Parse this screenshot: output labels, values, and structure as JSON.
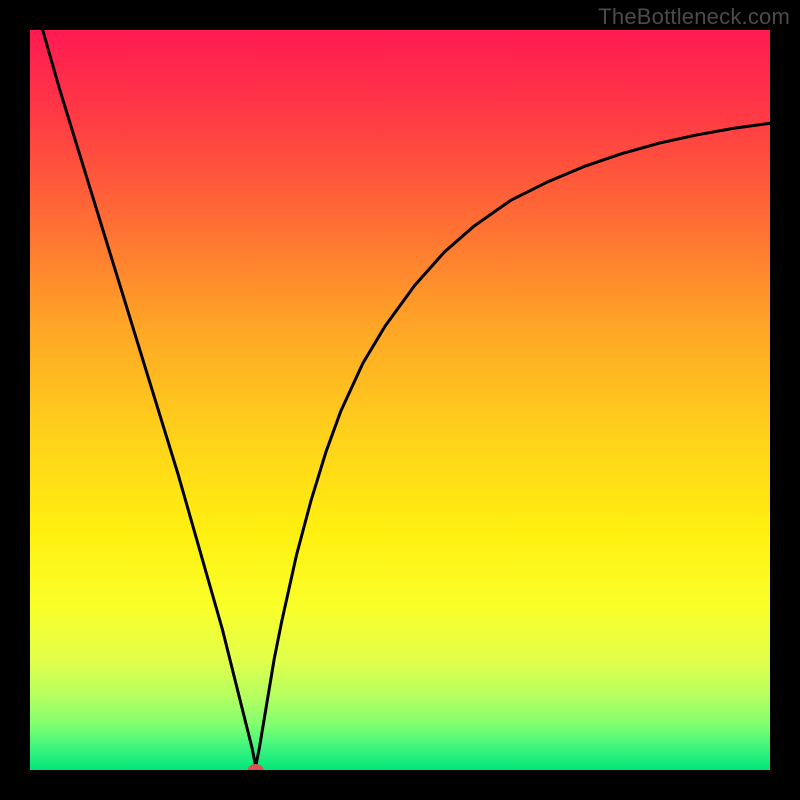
{
  "watermark": "TheBottleneck.com",
  "chart_data": {
    "type": "line",
    "title": "",
    "xlabel": "",
    "ylabel": "",
    "xlim": [
      0,
      100
    ],
    "ylim": [
      0,
      100
    ],
    "minimum_marker": {
      "x": 30.5,
      "y": 0
    },
    "series": [
      {
        "name": "curve",
        "x": [
          0,
          2,
          4,
          6,
          8,
          10,
          12,
          14,
          16,
          18,
          20,
          22,
          24,
          26,
          28,
          29,
          30,
          30.5,
          31,
          32,
          33,
          34,
          36,
          38,
          40,
          42,
          45,
          48,
          52,
          56,
          60,
          65,
          70,
          75,
          80,
          85,
          90,
          95,
          100
        ],
        "y": [
          106,
          99,
          92,
          85.5,
          79,
          72.5,
          66,
          59.5,
          53,
          46.5,
          40,
          33,
          26,
          19,
          11,
          7,
          3,
          0.5,
          3,
          9,
          15,
          20,
          29,
          36.5,
          43,
          48.5,
          55,
          60,
          65.5,
          70,
          73.5,
          77,
          79.5,
          81.6,
          83.3,
          84.7,
          85.8,
          86.7,
          87.4
        ]
      }
    ],
    "gradient_stops": [
      {
        "offset": 0.0,
        "color": "#ff1a52"
      },
      {
        "offset": 0.12,
        "color": "#ff3b44"
      },
      {
        "offset": 0.25,
        "color": "#ff6a35"
      },
      {
        "offset": 0.4,
        "color": "#ffa526"
      },
      {
        "offset": 0.55,
        "color": "#ffd21a"
      },
      {
        "offset": 0.68,
        "color": "#fff010"
      },
      {
        "offset": 0.78,
        "color": "#faff2a"
      },
      {
        "offset": 0.85,
        "color": "#e2ff4a"
      },
      {
        "offset": 0.9,
        "color": "#b6ff60"
      },
      {
        "offset": 0.94,
        "color": "#7fff70"
      },
      {
        "offset": 0.97,
        "color": "#3cf57e"
      },
      {
        "offset": 1.0,
        "color": "#00e67a"
      }
    ],
    "marker_color": "#d9534f",
    "curve_color": "#000000"
  }
}
